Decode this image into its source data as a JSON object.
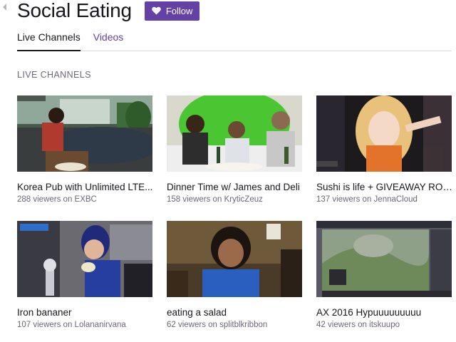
{
  "header": {
    "title": "Social Eating",
    "follow_label": "Follow"
  },
  "tabs": [
    {
      "label": "Live Channels",
      "active": true
    },
    {
      "label": "Videos",
      "active": false
    }
  ],
  "section": {
    "heading": "LIVE CHANNELS"
  },
  "channels": [
    {
      "title": "Korea Pub with Unlimited LTE...",
      "viewers": "288 viewers on EXBC"
    },
    {
      "title": "Dinner Time w/ James and Deli",
      "viewers": "158 viewers on KryticZeuz"
    },
    {
      "title": "Sushi is life + GIVEAWAY ROC...",
      "viewers": "137 viewers on JennaCloud"
    },
    {
      "title": "Iron bananer",
      "viewers": "107 viewers on Lolananirvana"
    },
    {
      "title": "eating a salad",
      "viewers": "62 viewers on splitblkribbon"
    },
    {
      "title": "AX 2016 Hypuuuuuuuuu",
      "viewers": "42 viewers on itskuupo"
    }
  ],
  "colors": {
    "accent": "#6441a5",
    "text": "#19171c",
    "muted": "#6e6779"
  },
  "icons": {
    "back": "back-arrow-icon",
    "follow": "heart-icon"
  }
}
